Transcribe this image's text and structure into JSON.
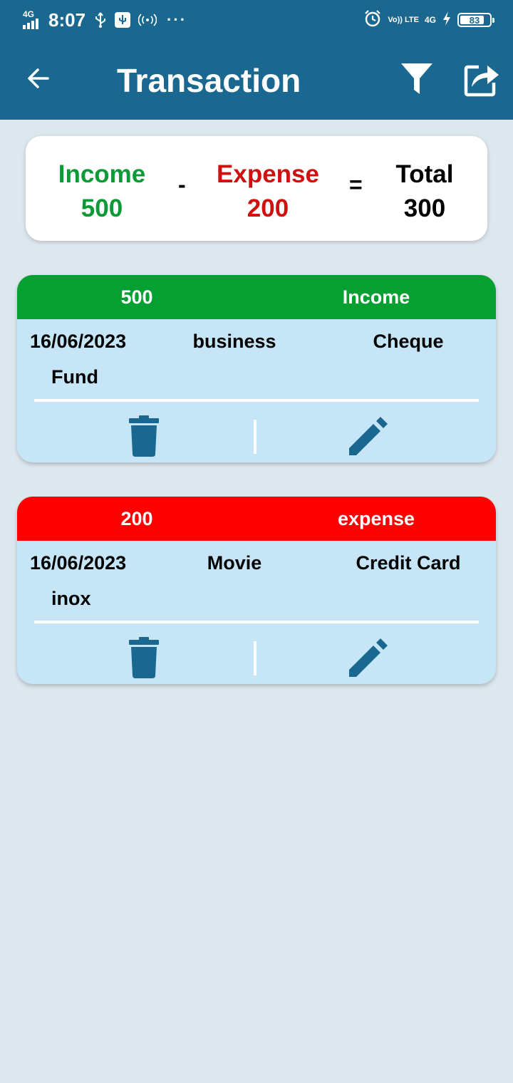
{
  "status_bar": {
    "network": "4G",
    "time": "8:07",
    "volte": "Vo)) LTE",
    "net_right": "4G",
    "battery_percent": "83",
    "battery_level": 0.83,
    "icons": [
      "usb-icon",
      "usb-debug-icon",
      "hotspot-icon",
      "more-dots-icon",
      "alarm-icon",
      "charging-icon"
    ]
  },
  "app_bar": {
    "title": "Transaction",
    "icons": [
      "back-arrow-icon",
      "filter-icon",
      "share-icon"
    ]
  },
  "summary": {
    "income_label": "Income",
    "income_value": "500",
    "minus": "-",
    "expense_label": "Expense",
    "expense_value": "200",
    "equals": "=",
    "total_label": "Total",
    "total_value": "300"
  },
  "transactions": [
    {
      "amount": "500",
      "type": "Income",
      "date": "16/06/2023",
      "category": "business",
      "mode": "Cheque",
      "note": "Fund",
      "header_color": "#06a032"
    },
    {
      "amount": "200",
      "type": "expense",
      "date": "16/06/2023",
      "category": "Movie",
      "mode": "Credit Card",
      "note": "inox",
      "header_color": "#ff0000"
    }
  ],
  "colors": {
    "primary": "#1a6890",
    "background": "#dde7ee",
    "card": "#c6e6f7",
    "income_text": "#0b9a35",
    "expense_text": "#d00f0f"
  }
}
